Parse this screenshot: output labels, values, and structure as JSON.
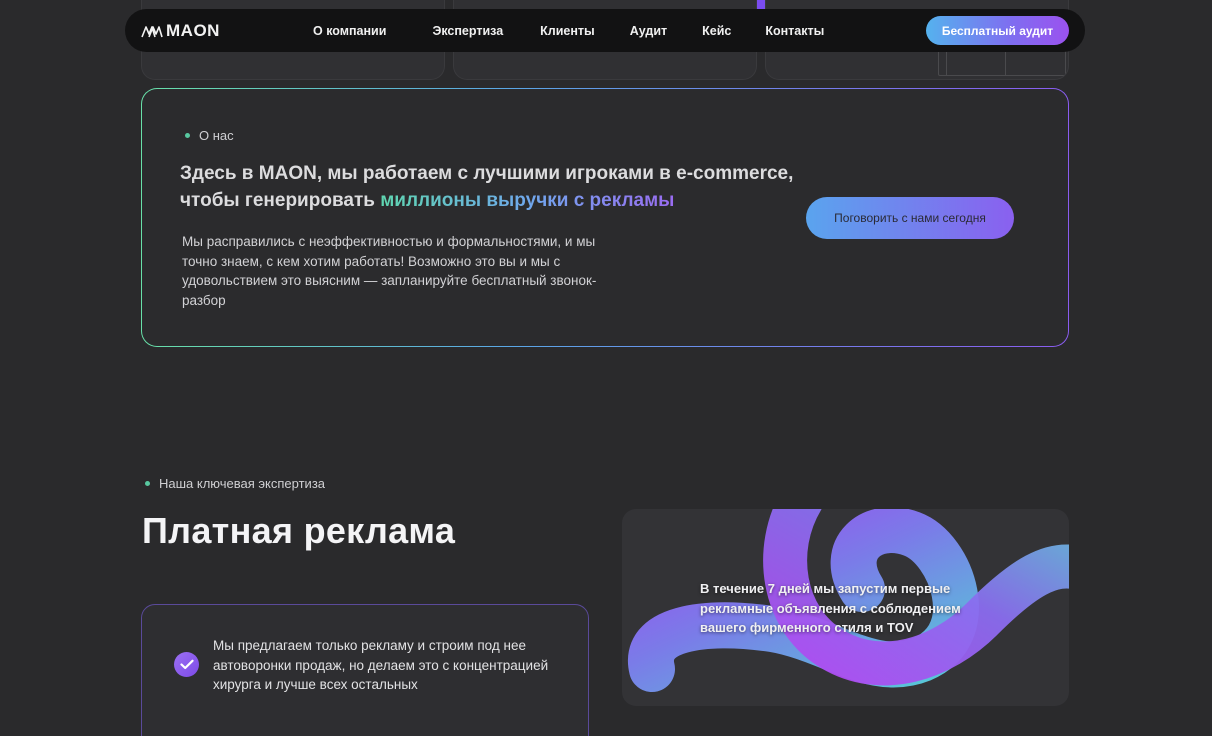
{
  "nav": {
    "logo_text": "MAON",
    "links": [
      "О компании",
      "Экспертиза",
      "Клиенты",
      "Аудит",
      "Кейс",
      "Контакты"
    ],
    "cta": "Бесплатный аудит"
  },
  "about": {
    "label": "О нас",
    "title_plain": "Здесь в MAON, мы работаем с лучшими игроками в e-commerce, чтобы генерировать ",
    "title_highlight": "миллионы выручки с рекламы",
    "body": "Мы расправились с неэффективностью и формальностями, и мы точно знаем, с кем хотим работать! Возможно это вы и мы с удовольствием это выясним — запланируйте бесплатный звонок-разбор",
    "cta": "Поговорить с нами сегодня"
  },
  "expertise": {
    "label": "Наша ключевая экспертиза",
    "title": "Платная реклама",
    "feature_text": "Мы предлагаем только рекламу и строим под нее автоворонки продаж, но делаем это с концентрацией хирурга и лучше всех остальных",
    "art_text": "В течение 7 дней мы запустим первые рекламные объявления с соблюдением вашего фирменного стиля и TOV"
  },
  "colors": {
    "background": "#2a2a2c",
    "accent_green": "#5fd6b0",
    "accent_blue": "#6fa8ec",
    "accent_purple": "#9a6cf2"
  },
  "icons": [
    "maon-logo-icon",
    "check-icon"
  ]
}
